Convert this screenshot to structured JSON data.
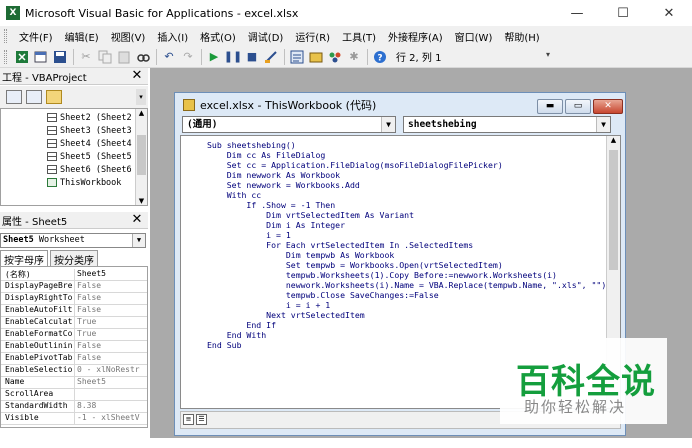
{
  "window": {
    "title": "Microsoft Visual Basic for Applications - excel.xlsx",
    "app_icon_letter": "X",
    "minimize": "—",
    "maximize": "☐",
    "close": "✕"
  },
  "menubar": {
    "items": [
      "文件(F)",
      "编辑(E)",
      "视图(V)",
      "插入(I)",
      "格式(O)",
      "调试(D)",
      "运行(R)",
      "工具(T)",
      "外接程序(A)",
      "窗口(W)",
      "帮助(H)"
    ]
  },
  "toolbar": {
    "cursor_position": "行 2, 列 1",
    "icons": [
      "excel-icon",
      "insert-module-icon",
      "save-icon",
      "cut-icon",
      "copy-icon",
      "paste-icon",
      "find-icon",
      "undo-icon",
      "redo-icon",
      "run-icon",
      "break-icon",
      "reset-icon",
      "design-mode-icon",
      "project-explorer-icon",
      "properties-icon",
      "object-browser-icon",
      "toolbox-icon",
      "help-icon"
    ]
  },
  "project_panel": {
    "title": "工程 - VBAProject",
    "close": "✕",
    "items": [
      "Sheet2 (Sheet2",
      "Sheet3 (Sheet3",
      "Sheet4 (Sheet4",
      "Sheet5 (Sheet5",
      "Sheet6 (Sheet6",
      "ThisWorkbook"
    ]
  },
  "properties_panel": {
    "title": "属性 - Sheet5",
    "close": "✕",
    "object_name": "Sheet5",
    "object_type": "Worksheet",
    "tabs": [
      "按字母序",
      "按分类序"
    ],
    "rows": [
      {
        "name": "(名称)",
        "value": "Sheet5"
      },
      {
        "name": "DisplayPageBre",
        "value": "False"
      },
      {
        "name": "DisplayRightTo",
        "value": "False"
      },
      {
        "name": "EnableAutoFilt",
        "value": "False"
      },
      {
        "name": "EnableCalculat",
        "value": "True"
      },
      {
        "name": "EnableFormatCo",
        "value": "True"
      },
      {
        "name": "EnableOutlinin",
        "value": "False"
      },
      {
        "name": "EnablePivotTab",
        "value": "False"
      },
      {
        "name": "EnableSelectio",
        "value": "0 - xlNoRestr"
      },
      {
        "name": "Name",
        "value": "Sheet5"
      },
      {
        "name": "ScrollArea",
        "value": ""
      },
      {
        "name": "StandardWidth",
        "value": "8.38"
      },
      {
        "name": "Visible",
        "value": "-1 - xlSheetV"
      }
    ]
  },
  "code_window": {
    "title": "excel.xlsx - ThisWorkbook (代码)",
    "object_combo": "(通用)",
    "procedure_combo": "sheetshebing",
    "lines": [
      "Sub sheetshebing()",
      "    Dim cc As FileDialog",
      "    Set cc = Application.FileDialog(msoFileDialogFilePicker)",
      "    Dim newwork As Workbook",
      "    Set newwork = Workbooks.Add",
      "    With cc",
      "        If .Show = -1 Then",
      "            Dim vrtSelectedItem As Variant",
      "            Dim i As Integer",
      "            i = 1",
      "            For Each vrtSelectedItem In .SelectedItems",
      "                Dim tempwb As Workbook",
      "                Set tempwb = Workbooks.Open(vrtSelectedItem)",
      "                tempwb.Worksheets(1).Copy Before:=newwork.Worksheets(i)",
      "                newwork.Worksheets(i).Name = VBA.Replace(tempwb.Name, \".xls\", \"\")",
      "                tempwb.Close SaveChanges:=False",
      "                i = i + 1",
      "            Next vrtSelectedItem",
      "        End If",
      "    End With",
      "End Sub"
    ]
  },
  "watermark": {
    "logo": "百科全说",
    "subtitle": "助你轻松解决"
  },
  "colors": {
    "watermark_green": "#149e3d",
    "code_text": "#00007b",
    "mdi_background": "#aaaaaa"
  }
}
